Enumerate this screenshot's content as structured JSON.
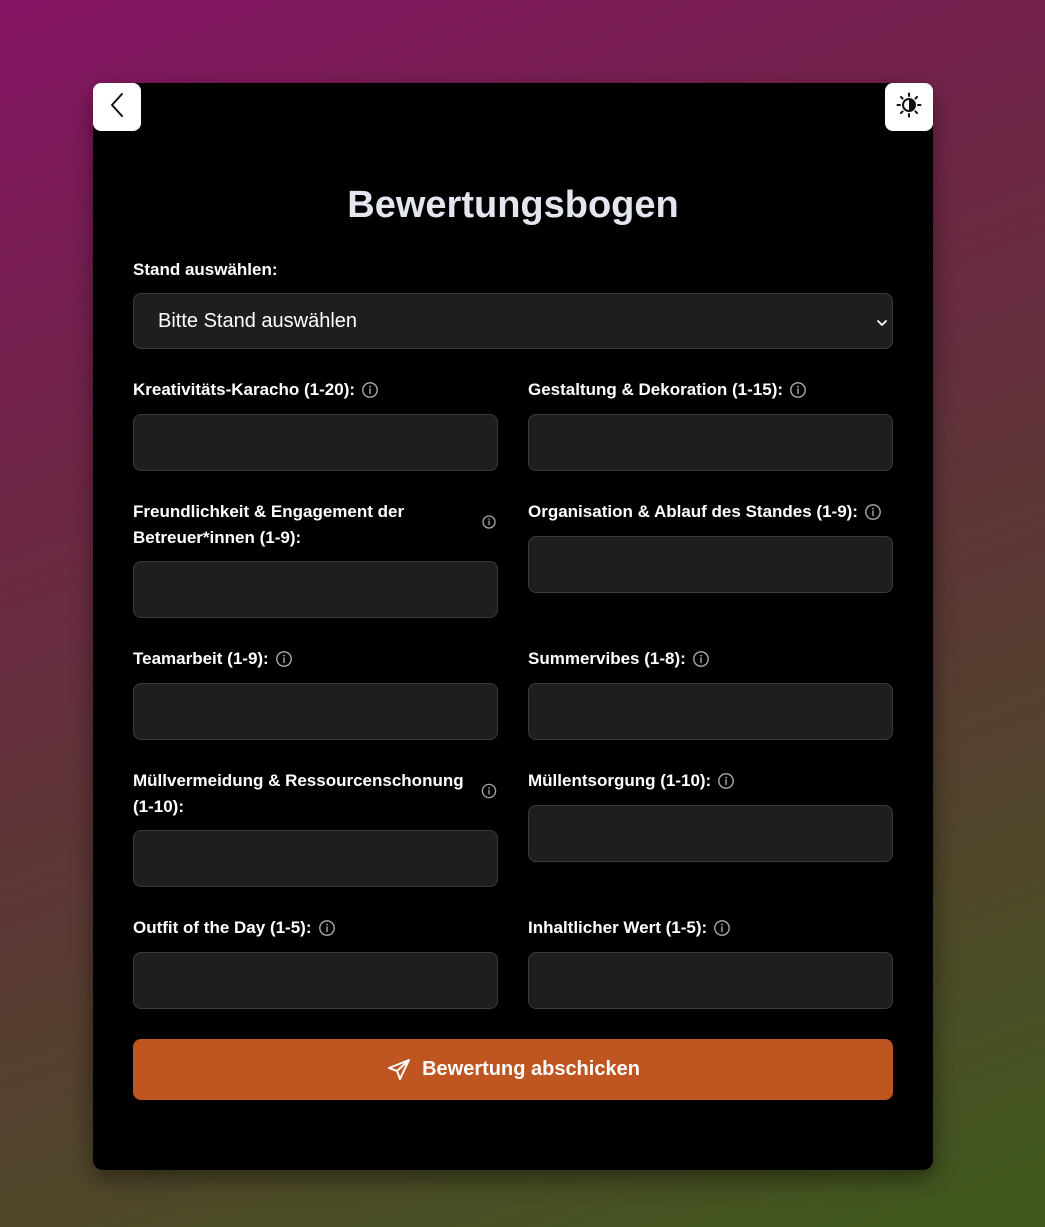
{
  "header": {
    "back_icon": "chevron-left-icon",
    "theme_icon": "sun-icon"
  },
  "form": {
    "title": "Bewertungsbogen",
    "stand": {
      "label": "Stand auswählen:",
      "selected": "Bitte Stand auswählen"
    },
    "fields": [
      {
        "label": "Kreativitäts-Karacho (1-20):",
        "value": ""
      },
      {
        "label": "Gestaltung & Dekoration (1-15):",
        "value": ""
      },
      {
        "label": "Freundlichkeit & Engagement der Betreuer*innen (1-9):",
        "value": ""
      },
      {
        "label": "Organisation & Ablauf des Standes (1-9):",
        "value": ""
      },
      {
        "label": "Teamarbeit (1-9):",
        "value": ""
      },
      {
        "label": "Summervibes (1-8):",
        "value": ""
      },
      {
        "label": "Müllvermeidung & Ressourcenschonung (1-10):",
        "value": ""
      },
      {
        "label": "Müllentsorgung (1-10):",
        "value": ""
      },
      {
        "label": "Outfit of the Day (1-5):",
        "value": ""
      },
      {
        "label": "Inhaltlicher Wert (1-5):",
        "value": ""
      }
    ],
    "submit_label": "Bewertung abschicken",
    "submit_icon": "send-icon"
  },
  "colors": {
    "card_bg": "#000000",
    "input_bg": "#1e1e1e",
    "submit_bg": "#bf5521",
    "title_color": "#e3e6ef"
  }
}
